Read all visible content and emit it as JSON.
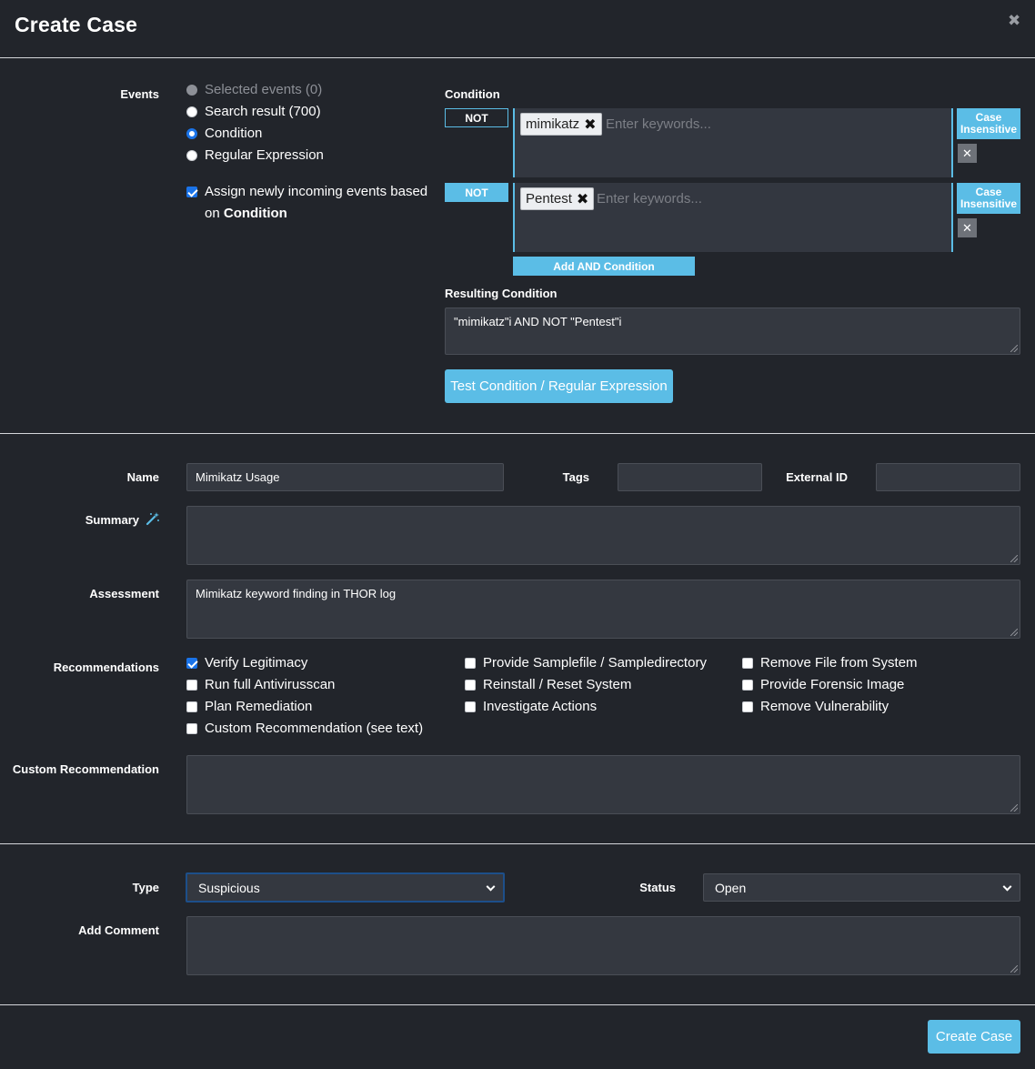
{
  "dialog": {
    "title": "Create Case",
    "close_icon": "close-icon"
  },
  "events": {
    "label": "Events",
    "options": [
      {
        "label": "Selected events (0)",
        "state": "disabled"
      },
      {
        "label": "Search result (700)",
        "state": "unchecked"
      },
      {
        "label": "Condition",
        "state": "checked"
      },
      {
        "label": "Regular Expression",
        "state": "unchecked"
      }
    ],
    "assign_line1": "Assign newly incoming events based",
    "assign_line2_prefix": "on ",
    "assign_line2_bold": "Condition",
    "assign_checked": true
  },
  "condition": {
    "label": "Condition",
    "rows": [
      {
        "not_label": "NOT",
        "not_active": false,
        "tag": "mimikatz",
        "placeholder": "Enter keywords...",
        "case_line1": "Case",
        "case_line2": "Insensitive",
        "remove_icon": "close-icon"
      },
      {
        "not_label": "NOT",
        "not_active": true,
        "tag": "Pentest",
        "placeholder": "Enter keywords...",
        "case_line1": "Case",
        "case_line2": "Insensitive",
        "remove_icon": "close-icon"
      }
    ],
    "add_and_label": "Add AND Condition",
    "resulting_label": "Resulting Condition",
    "resulting_value": "\"mimikatz\"i AND NOT \"Pentest\"i",
    "test_button": "Test Condition / Regular Expression"
  },
  "details": {
    "name_label": "Name",
    "name_value": "Mimikatz Usage",
    "tags_label": "Tags",
    "tags_value": "",
    "external_id_label": "External ID",
    "external_id_value": "",
    "summary_label": "Summary",
    "summary_icon": "magic-wand-icon",
    "summary_value": "",
    "assessment_label": "Assessment",
    "assessment_value": "Mimikatz keyword finding in THOR log",
    "recommendations_label": "Recommendations",
    "recommendations": [
      {
        "label": "Verify Legitimacy",
        "checked": true
      },
      {
        "label": "Run full Antivirusscan",
        "checked": false
      },
      {
        "label": "Plan Remediation",
        "checked": false
      },
      {
        "label": "Custom Recommendation (see text)",
        "checked": false
      },
      {
        "label": "Provide Samplefile / Sampledirectory",
        "checked": false
      },
      {
        "label": "Reinstall / Reset System",
        "checked": false
      },
      {
        "label": "Investigate Actions",
        "checked": false
      },
      {
        "label": "Remove File from System",
        "checked": false
      },
      {
        "label": "Provide Forensic Image",
        "checked": false
      },
      {
        "label": "Remove Vulnerability",
        "checked": false
      }
    ],
    "custom_rec_label": "Custom Recommendation",
    "custom_rec_value": ""
  },
  "meta": {
    "type_label": "Type",
    "type_value": "Suspicious",
    "status_label": "Status",
    "status_value": "Open",
    "comment_label": "Add Comment",
    "comment_value": ""
  },
  "footer": {
    "create_button": "Create Case"
  },
  "colors": {
    "accent": "#5bbde6",
    "background": "#22252b",
    "field": "#343840",
    "checkbox_blue": "#1a73e8"
  }
}
